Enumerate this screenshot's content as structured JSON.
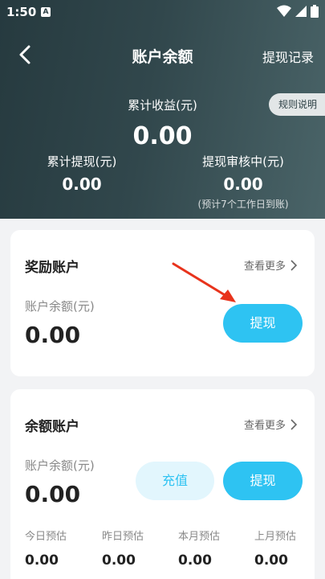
{
  "status_bar": {
    "time": "1:50",
    "badge": "A"
  },
  "nav": {
    "title": "账户余额",
    "right_link": "提现记录"
  },
  "summary": {
    "rule_button": "规则说明",
    "total_label": "累计收益(元)",
    "total_value": "0.00",
    "withdrawn_label": "累计提现(元)",
    "withdrawn_value": "0.00",
    "pending_label": "提现审核中(元)",
    "pending_value": "0.00",
    "pending_note": "(预计7个工作日到账)"
  },
  "reward_account": {
    "title": "奖励账户",
    "more": "查看更多",
    "balance_label": "账户余额(元)",
    "balance_value": "0.00",
    "withdraw_button": "提现"
  },
  "balance_account": {
    "title": "余额账户",
    "more": "查看更多",
    "balance_label": "账户余额(元)",
    "balance_value": "0.00",
    "recharge_button": "充值",
    "withdraw_button": "提现",
    "estimates": [
      {
        "label": "今日预估",
        "value": "0.00"
      },
      {
        "label": "昨日预估",
        "value": "0.00"
      },
      {
        "label": "本月预估",
        "value": "0.00"
      },
      {
        "label": "上月预估",
        "value": "0.00"
      }
    ]
  },
  "colors": {
    "accent": "#2ec3f2",
    "header": "#2b3f44",
    "annotation": "#e8331c"
  }
}
